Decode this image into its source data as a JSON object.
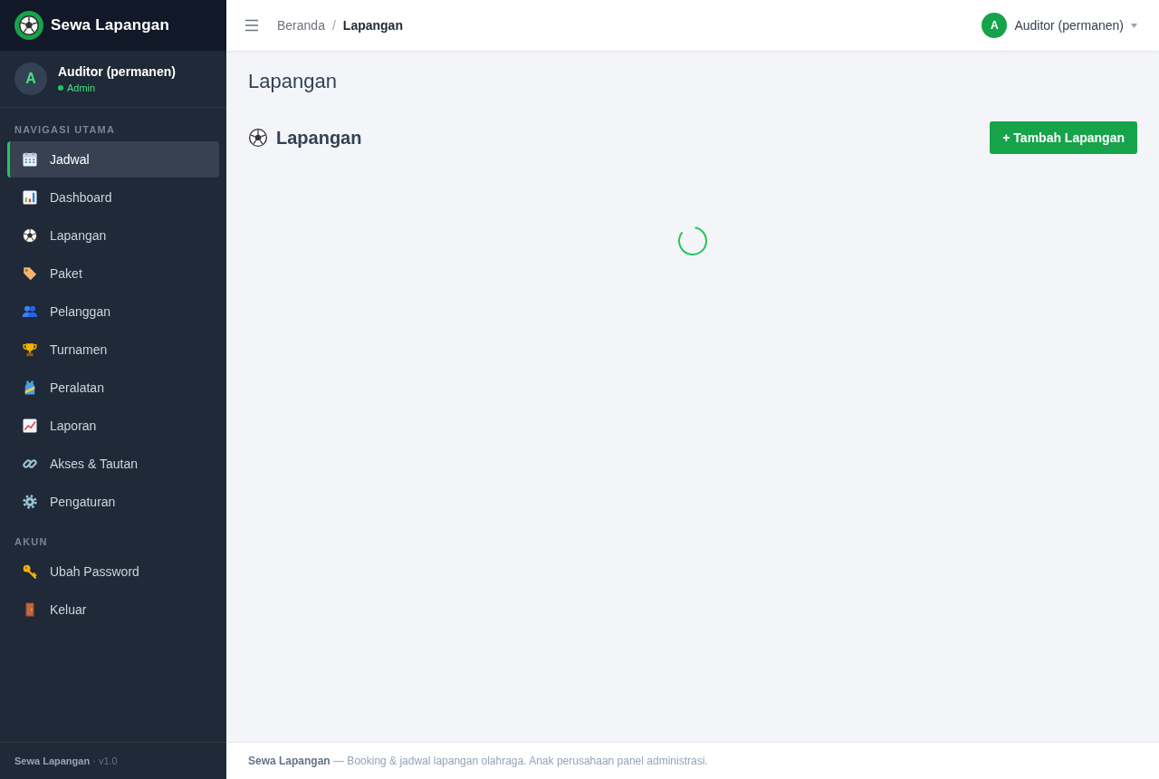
{
  "sidebar": {
    "brand": {
      "title": "Sewa Lapangan"
    },
    "user": {
      "initial": "A",
      "name": "Auditor (permanen)",
      "role": "Admin"
    },
    "sections": [
      {
        "heading": "NAVIGASI UTAMA",
        "items": [
          {
            "label": "Jadwal",
            "selected": true
          },
          {
            "label": "Dashboard",
            "selected": false
          },
          {
            "label": "Lapangan",
            "selected": false
          },
          {
            "label": "Paket",
            "selected": false
          },
          {
            "label": "Pelanggan",
            "selected": false
          },
          {
            "label": "Turnamen",
            "selected": false
          },
          {
            "label": "Peralatan",
            "selected": false
          },
          {
            "label": "Laporan",
            "selected": false
          },
          {
            "label": "Akses & Tautan",
            "selected": false
          },
          {
            "label": "Pengaturan",
            "selected": false
          }
        ]
      },
      {
        "heading": "AKUN",
        "items": [
          {
            "label": "Ubah Password",
            "selected": false
          },
          {
            "label": "Keluar",
            "selected": false
          }
        ]
      }
    ],
    "footer": "**Sewa Lapangan** · v1.0"
  },
  "topbar": {
    "breadcrumb": [
      {
        "label": "Beranda",
        "current": false
      },
      {
        "separator": "/",
        "label": "Lapangan",
        "current": true
      }
    ],
    "user": {
      "initial": "A",
      "name": "Auditor (permanen)"
    }
  },
  "page": {
    "title": "Lapangan",
    "card": {
      "title": "Lapangan",
      "button": "+ Tambah Lapangan",
      "loading": true
    }
  },
  "footer": "**Sewa Lapangan** — Booking & jadwal lapangan olahraga. Anak perusahaan panel administrasi."
}
